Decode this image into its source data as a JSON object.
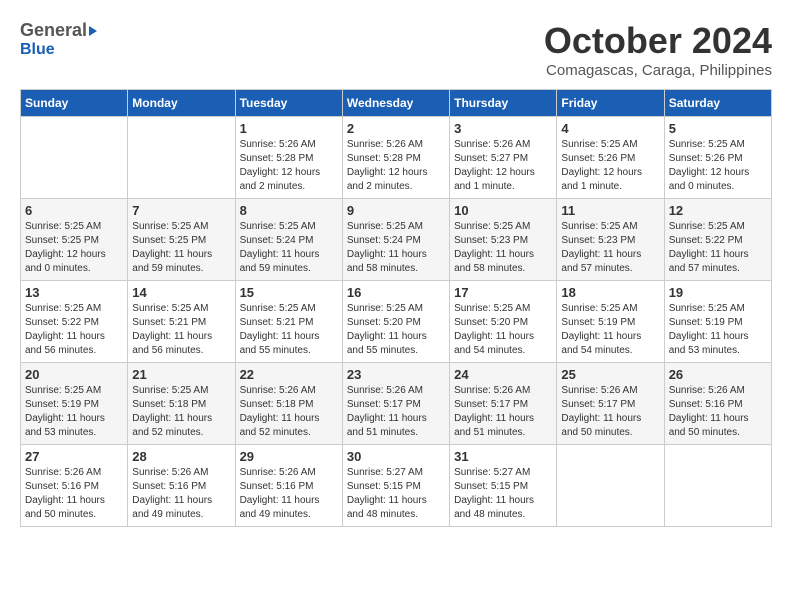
{
  "header": {
    "logo_general": "General",
    "logo_blue": "Blue",
    "month_title": "October 2024",
    "location": "Comagascas, Caraga, Philippines"
  },
  "days_of_week": [
    "Sunday",
    "Monday",
    "Tuesday",
    "Wednesday",
    "Thursday",
    "Friday",
    "Saturday"
  ],
  "weeks": [
    [
      {
        "day": "",
        "info": ""
      },
      {
        "day": "",
        "info": ""
      },
      {
        "day": "1",
        "info": "Sunrise: 5:26 AM\nSunset: 5:28 PM\nDaylight: 12 hours\nand 2 minutes."
      },
      {
        "day": "2",
        "info": "Sunrise: 5:26 AM\nSunset: 5:28 PM\nDaylight: 12 hours\nand 2 minutes."
      },
      {
        "day": "3",
        "info": "Sunrise: 5:26 AM\nSunset: 5:27 PM\nDaylight: 12 hours\nand 1 minute."
      },
      {
        "day": "4",
        "info": "Sunrise: 5:25 AM\nSunset: 5:26 PM\nDaylight: 12 hours\nand 1 minute."
      },
      {
        "day": "5",
        "info": "Sunrise: 5:25 AM\nSunset: 5:26 PM\nDaylight: 12 hours\nand 0 minutes."
      }
    ],
    [
      {
        "day": "6",
        "info": "Sunrise: 5:25 AM\nSunset: 5:25 PM\nDaylight: 12 hours\nand 0 minutes."
      },
      {
        "day": "7",
        "info": "Sunrise: 5:25 AM\nSunset: 5:25 PM\nDaylight: 11 hours\nand 59 minutes."
      },
      {
        "day": "8",
        "info": "Sunrise: 5:25 AM\nSunset: 5:24 PM\nDaylight: 11 hours\nand 59 minutes."
      },
      {
        "day": "9",
        "info": "Sunrise: 5:25 AM\nSunset: 5:24 PM\nDaylight: 11 hours\nand 58 minutes."
      },
      {
        "day": "10",
        "info": "Sunrise: 5:25 AM\nSunset: 5:23 PM\nDaylight: 11 hours\nand 58 minutes."
      },
      {
        "day": "11",
        "info": "Sunrise: 5:25 AM\nSunset: 5:23 PM\nDaylight: 11 hours\nand 57 minutes."
      },
      {
        "day": "12",
        "info": "Sunrise: 5:25 AM\nSunset: 5:22 PM\nDaylight: 11 hours\nand 57 minutes."
      }
    ],
    [
      {
        "day": "13",
        "info": "Sunrise: 5:25 AM\nSunset: 5:22 PM\nDaylight: 11 hours\nand 56 minutes."
      },
      {
        "day": "14",
        "info": "Sunrise: 5:25 AM\nSunset: 5:21 PM\nDaylight: 11 hours\nand 56 minutes."
      },
      {
        "day": "15",
        "info": "Sunrise: 5:25 AM\nSunset: 5:21 PM\nDaylight: 11 hours\nand 55 minutes."
      },
      {
        "day": "16",
        "info": "Sunrise: 5:25 AM\nSunset: 5:20 PM\nDaylight: 11 hours\nand 55 minutes."
      },
      {
        "day": "17",
        "info": "Sunrise: 5:25 AM\nSunset: 5:20 PM\nDaylight: 11 hours\nand 54 minutes."
      },
      {
        "day": "18",
        "info": "Sunrise: 5:25 AM\nSunset: 5:19 PM\nDaylight: 11 hours\nand 54 minutes."
      },
      {
        "day": "19",
        "info": "Sunrise: 5:25 AM\nSunset: 5:19 PM\nDaylight: 11 hours\nand 53 minutes."
      }
    ],
    [
      {
        "day": "20",
        "info": "Sunrise: 5:25 AM\nSunset: 5:19 PM\nDaylight: 11 hours\nand 53 minutes."
      },
      {
        "day": "21",
        "info": "Sunrise: 5:25 AM\nSunset: 5:18 PM\nDaylight: 11 hours\nand 52 minutes."
      },
      {
        "day": "22",
        "info": "Sunrise: 5:26 AM\nSunset: 5:18 PM\nDaylight: 11 hours\nand 52 minutes."
      },
      {
        "day": "23",
        "info": "Sunrise: 5:26 AM\nSunset: 5:17 PM\nDaylight: 11 hours\nand 51 minutes."
      },
      {
        "day": "24",
        "info": "Sunrise: 5:26 AM\nSunset: 5:17 PM\nDaylight: 11 hours\nand 51 minutes."
      },
      {
        "day": "25",
        "info": "Sunrise: 5:26 AM\nSunset: 5:17 PM\nDaylight: 11 hours\nand 50 minutes."
      },
      {
        "day": "26",
        "info": "Sunrise: 5:26 AM\nSunset: 5:16 PM\nDaylight: 11 hours\nand 50 minutes."
      }
    ],
    [
      {
        "day": "27",
        "info": "Sunrise: 5:26 AM\nSunset: 5:16 PM\nDaylight: 11 hours\nand 50 minutes."
      },
      {
        "day": "28",
        "info": "Sunrise: 5:26 AM\nSunset: 5:16 PM\nDaylight: 11 hours\nand 49 minutes."
      },
      {
        "day": "29",
        "info": "Sunrise: 5:26 AM\nSunset: 5:16 PM\nDaylight: 11 hours\nand 49 minutes."
      },
      {
        "day": "30",
        "info": "Sunrise: 5:27 AM\nSunset: 5:15 PM\nDaylight: 11 hours\nand 48 minutes."
      },
      {
        "day": "31",
        "info": "Sunrise: 5:27 AM\nSunset: 5:15 PM\nDaylight: 11 hours\nand 48 minutes."
      },
      {
        "day": "",
        "info": ""
      },
      {
        "day": "",
        "info": ""
      }
    ]
  ]
}
